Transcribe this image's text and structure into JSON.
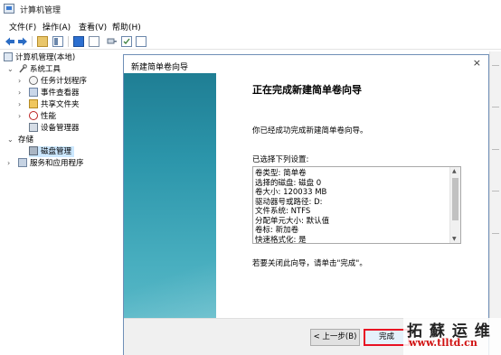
{
  "window": {
    "title": "计算机管理"
  },
  "menu": {
    "items": [
      "文件(F)",
      "操作(A)",
      "查看(V)",
      "帮助(H)"
    ]
  },
  "toolbar": {
    "icons": [
      "back-arrow-icon",
      "forward-arrow-icon",
      "up-folder-icon",
      "show-hide-tree-icon",
      "properties-icon",
      "help-icon",
      "connect-icon",
      "check-icon",
      "properties2-icon"
    ]
  },
  "tree": {
    "root": "计算机管理(本地)",
    "system_tools": "系统工具",
    "task_scheduler": "任务计划程序",
    "event_viewer": "事件查看器",
    "shared_folders": "共享文件夹",
    "performance": "性能",
    "device_manager": "设备管理器",
    "storage": "存储",
    "disk_management": "磁盘管理",
    "services_apps": "服务和应用程序"
  },
  "dialog": {
    "title": "新建简单卷向导",
    "close": "×",
    "heading": "正在完成新建简单卷向导",
    "intro": "你已经成功完成新建简单卷向导。",
    "settings_label": "已选择下列设置:",
    "settings": [
      "卷类型: 简单卷",
      "选择的磁盘: 磁盘 0",
      "卷大小: 120033 MB",
      "驱动器号或路径: D:",
      "文件系统: NTFS",
      "分配单元大小: 默认值",
      "卷标: 新加卷",
      "快速格式化: 是"
    ],
    "footer_note": "若要关闭此向导，请单击\"完成\"。",
    "back_button": "< 上一步(B)",
    "finish_button": "完成"
  },
  "watermark": {
    "top": "拓 蘇 运 维",
    "bottom": "www.tlltd.cn"
  },
  "colors": {
    "banner": "#2c96ab",
    "highlight": "#e81123",
    "selection": "#cce8ff",
    "watermark_red": "#d01010"
  }
}
